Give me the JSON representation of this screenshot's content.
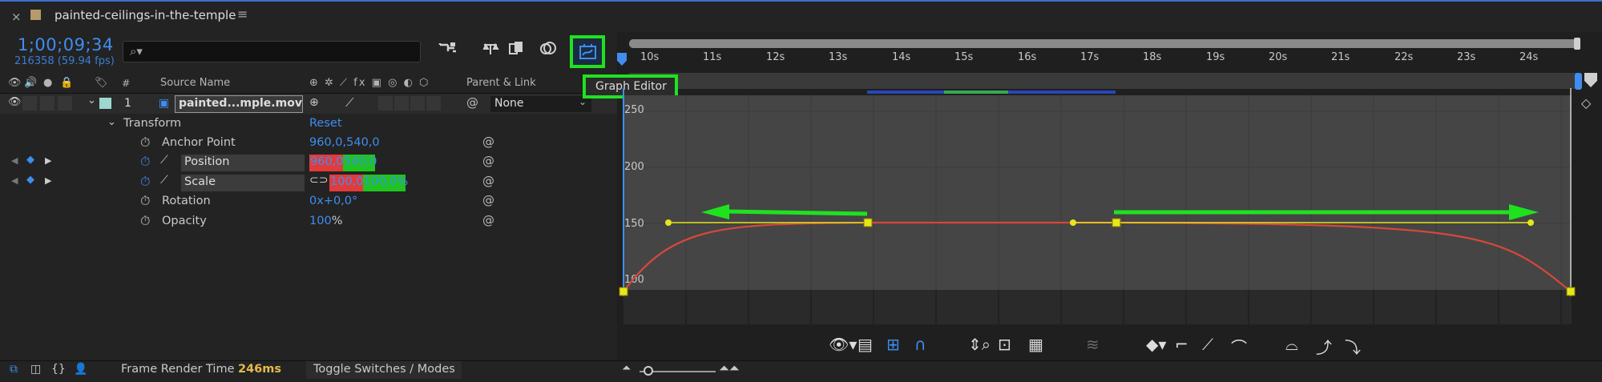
{
  "tab": {
    "title": "painted-ceilings-in-the-temple",
    "close": "×",
    "menu": "≡"
  },
  "header": {
    "timecode": "1;00;09;34",
    "framerate": "216358 (59.94 fps)",
    "search_placeholder": ""
  },
  "tooltip": {
    "label": "Graph Editor"
  },
  "columns": {
    "num": "#",
    "source_name": "Source Name",
    "parent_link": "Parent & Link"
  },
  "layer": {
    "number": "1",
    "name": "painted...mple.mov",
    "parent": "None"
  },
  "properties": {
    "transform": "Transform",
    "reset": "Reset",
    "anchor_label": "Anchor Point",
    "anchor_value": "960,0,540,0",
    "position_label": "Position",
    "position_x": "960,0,",
    "position_y": "540,0",
    "scale_label": "Scale",
    "scale_x": "100,0,",
    "scale_y": "100,0%",
    "rotation_label": "Rotation",
    "rotation_value": "0x+0,0°",
    "opacity_label": "Opacity",
    "opacity_value": "100",
    "opacity_unit": "%"
  },
  "ruler": {
    "ticks": [
      "10s",
      "11s",
      "12s",
      "13s",
      "14s",
      "15s",
      "16s",
      "17s",
      "18s",
      "19s",
      "20s",
      "21s",
      "22s",
      "23s",
      "24s"
    ]
  },
  "graph": {
    "y_labels": [
      "250",
      "200",
      "150",
      "100"
    ]
  },
  "status": {
    "frame_render_label": "Frame Render Time",
    "frame_render_value": "246ms",
    "toggle_label": "Toggle Switches / Modes"
  },
  "colors": {
    "accent": "#3f8ef0",
    "highlight": "#1fe21f",
    "position_x_bg": "#e23b3b",
    "position_y_bg": "#1fc41f",
    "curve": "#d6483a",
    "handle": "#e6e61a"
  }
}
